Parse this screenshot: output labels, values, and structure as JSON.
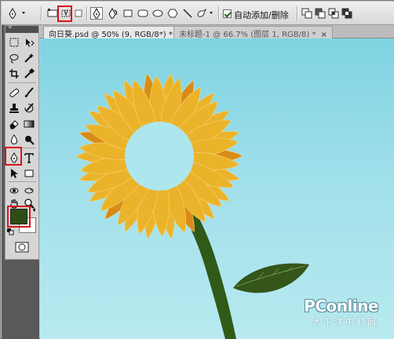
{
  "options_bar": {
    "auto_add_delete": {
      "label": "自动添加/删除",
      "checked": true
    },
    "tool_icons": [
      "pen-tool-dropdown",
      "shape-layers-mode",
      "paths-mode",
      "fill-pixels-mode",
      "pen-icon",
      "freeform-pen-icon",
      "rectangle-icon",
      "rounded-rectangle-icon",
      "ellipse-icon",
      "polygon-icon",
      "line-icon",
      "custom-shape-icon",
      "path-combine-icons"
    ]
  },
  "tabs": [
    {
      "label": "向日葵.psd @ 50% (9, RGB/8*) *",
      "active": true
    },
    {
      "label": "未标题-1 @ 66.7% (图层 1, RGB/8) *",
      "active": false
    }
  ],
  "colors": {
    "foreground": "#2e4d14",
    "background": "#ffffff",
    "sky": "#8fd8e6",
    "petal": "#ebb32a",
    "petal_dark": "#d88b16",
    "stem": "#2f5a17",
    "highlight": "#d8141a"
  },
  "watermark": {
    "brand": "PConline",
    "subtitle": "太平洋电脑网"
  }
}
